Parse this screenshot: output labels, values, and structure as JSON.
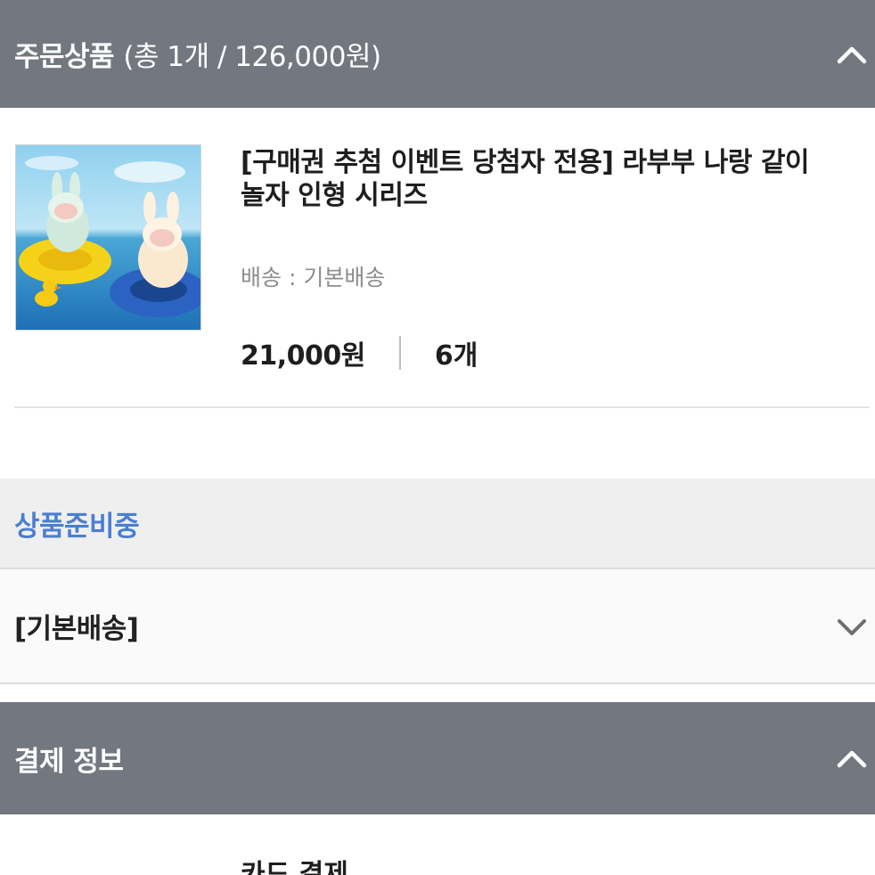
{
  "order_section": {
    "title": "주문상품",
    "summary": "(총 1개 / 126,000원)"
  },
  "product": {
    "image_alt": "labubu-toy-on-float-image",
    "name_line1": "[구매권 추첨 이벤트 당첨자 전용] 라부부 나랑 같이",
    "name_line2": "놀자 인형 시리즈",
    "shipping": "배송 : 기본배송",
    "price": "21,000원",
    "quantity": "6개"
  },
  "status": {
    "label": "상품준비중"
  },
  "delivery": {
    "label": "[기본배송]"
  },
  "payment_section": {
    "title": "결제 정보",
    "method": "카드 결제"
  },
  "colors": {
    "header_bg": "#737780",
    "status_blue": "#4a7fd0",
    "status_bg": "#efefef"
  }
}
